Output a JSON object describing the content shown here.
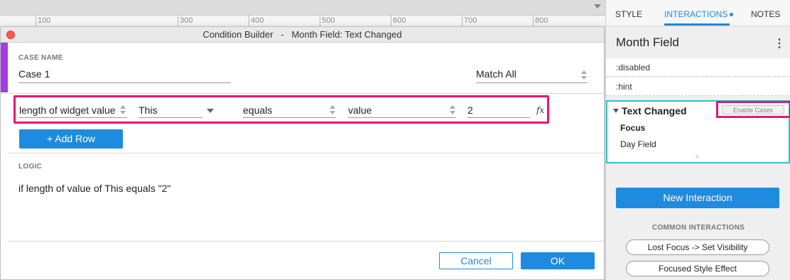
{
  "ruler": {
    "marks": [
      "100",
      "300",
      "400",
      "500",
      "600",
      "700",
      "800"
    ]
  },
  "dialog": {
    "title": "Condition Builder   -   Month Field: Text Changed",
    "case_name_label": "CASE NAME",
    "case_name_value": "Case 1",
    "match_select": "Match All",
    "condition": {
      "target": "length of widget value",
      "widget": "This",
      "operator": "equals",
      "type": "value",
      "value": "2",
      "fx_label": "fx"
    },
    "add_row_label": "+ Add Row",
    "logic_label": "LOGIC",
    "logic_text": "if length of value of This equals \"2\"",
    "cancel_label": "Cancel",
    "ok_label": "OK"
  },
  "panel": {
    "tabs": {
      "style": "STYLE",
      "interactions": "INTERACTIONS",
      "notes": "NOTES"
    },
    "widget_name": "Month Field",
    "rows": {
      "disabled": ":disabled",
      "hint": ":hint"
    },
    "event": {
      "title": "Text Changed",
      "enable_cases": "Enable Cases",
      "actions": [
        "Focus",
        "Day Field"
      ],
      "add_glyph": "+"
    },
    "new_interaction": "New Interaction",
    "common_label": "COMMON INTERACTIONS",
    "common": [
      "Lost Focus -> Set Visibility",
      "Focused Style Effect"
    ]
  },
  "colors": {
    "accent_purple": "#a43be8",
    "highlight_pink": "#e5177a",
    "primary_blue": "#1f8bde",
    "teal": "#2fc3c7"
  }
}
